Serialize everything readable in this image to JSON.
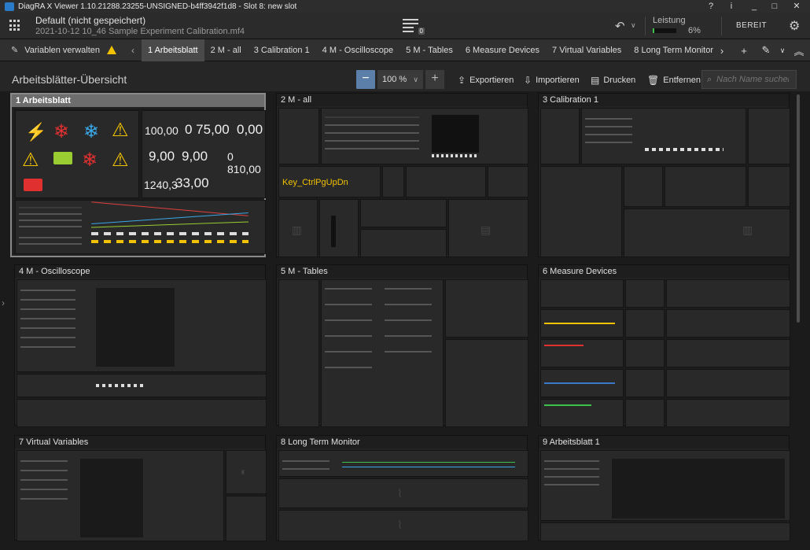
{
  "window": {
    "title": "DiagRA X Viewer 1.10.21288.23255-UNSIGNED-b4ff3942f1d8 - Slot 8: new slot",
    "help": "?",
    "info": "i",
    "minimize": "_",
    "maximize": "□",
    "close": "✕"
  },
  "header": {
    "doc_title": "Default (nicht gespeichert)",
    "doc_sub": "2021-10-12 10_46 Sample Experiment Calibration.mf4",
    "badge": "0",
    "leistung_label": "Leistung",
    "leistung_value": "6%",
    "leistung_fraction": 0.06,
    "status": "BEREIT",
    "undo": "↶",
    "chevron": "∨",
    "gear": "⚙"
  },
  "tabbar": {
    "variables_label": "Variablen verwalten",
    "prev": "‹",
    "next": "›",
    "add": "+",
    "edit": "✎",
    "edit_chev": "∨",
    "collapse": "︽",
    "tabs": [
      "1 Arbeitsblatt",
      "2 M - all",
      "3 Calibration 1",
      "4 M - Oscilloscope",
      "5 M - Tables",
      "6 Measure Devices",
      "7 Virtual Variables",
      "8 Long Term Monitor"
    ]
  },
  "toolbar": {
    "title": "Arbeitsblätter-Übersicht",
    "zoom": "100 %",
    "zoom_minus": "−",
    "zoom_plus": "+",
    "export": "Exportieren",
    "import": "Importieren",
    "print": "Drucken",
    "remove": "Entfernen",
    "search_placeholder": "Nach Name suchen"
  },
  "cards": [
    "1 Arbeitsblatt",
    "2 M - all",
    "3 Calibration 1",
    "4 M - Oscilloscope",
    "5 M - Tables",
    "6 Measure Devices",
    "7 Virtual Variables",
    "8 Long Term Monitor",
    "9 Arbeitsblatt 1"
  ],
  "ws1": {
    "v1": "100,00",
    "v2": "0 75,00",
    "v3": "0,00",
    "v4": "9,00",
    "v5": "9,00",
    "v6": "0 810,00",
    "v7": "1240,3",
    "v8": "33,00"
  },
  "ws2": {
    "key_label": "Key_CtrlPgUpDn"
  },
  "colors": {
    "accent": "#5b7fa8",
    "warn": "#f2c200",
    "ok": "#3cc24a",
    "alert": "#e03030",
    "cold": "#3aa8e8"
  }
}
